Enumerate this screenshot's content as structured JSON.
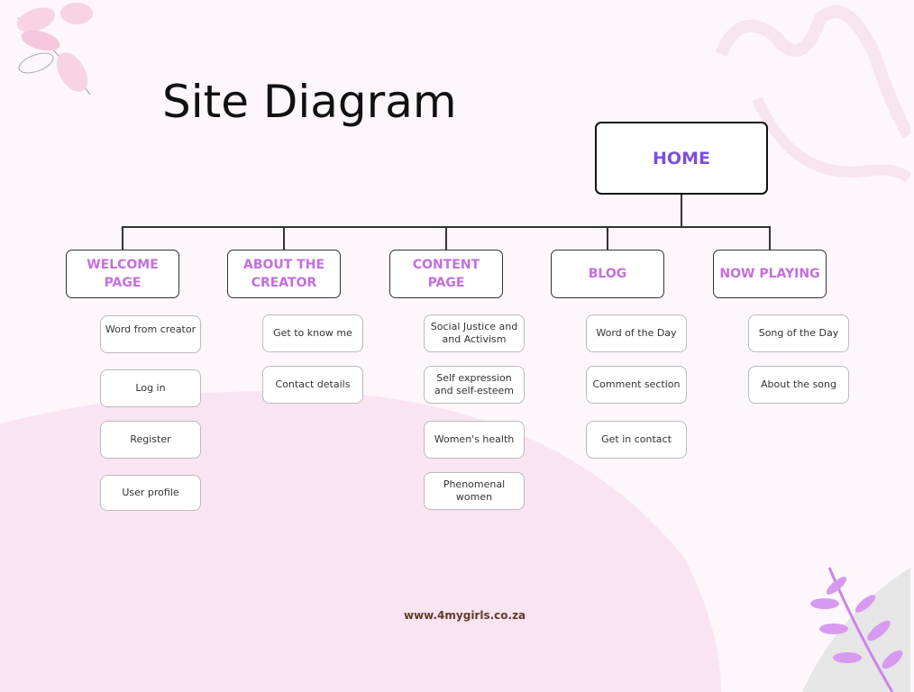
{
  "title": "Site Diagram",
  "home": "HOME",
  "categories": [
    {
      "label": "WELCOME PAGE",
      "items": [
        "Word from creator",
        "Log in",
        "Register",
        "User profile"
      ]
    },
    {
      "label": "ABOUT THE CREATOR",
      "items": [
        "Get to know me",
        "Contact details"
      ]
    },
    {
      "label": "CONTENT PAGE",
      "items": [
        "Social Justice and and Activism",
        "Self expression and self-esteem",
        "Women's health",
        "Phenomenal women"
      ]
    },
    {
      "label": "BLOG",
      "items": [
        "Word of the Day",
        "Comment section",
        "Get in contact"
      ]
    },
    {
      "label": "NOW PLAYING",
      "items": [
        "Song of the Day",
        "About the song"
      ]
    }
  ],
  "footer_url": "www.4mygirls.co.za",
  "colors": {
    "home_text": "#7b4ee0",
    "category_text": "#c46ee0",
    "background": "#fdf6fb",
    "blob": "#fbe4f2"
  }
}
